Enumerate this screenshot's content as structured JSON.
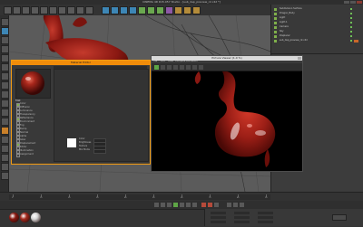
{
  "app": {
    "title": "CINEMA 4D R15.057 Studio - [sub_dep_preview_r2.c4d *]"
  },
  "toolbar": {
    "icons": [
      "undo-icon",
      "redo-icon",
      "select-icon",
      "move-icon",
      "scale-icon",
      "rotate-icon",
      "axis-x-icon",
      "axis-y-icon",
      "axis-z-icon",
      "coord-icon",
      "render-view-icon",
      "render-picture-icon",
      "render-settings-icon",
      "cube-icon",
      "pen-icon",
      "subdivision-icon",
      "array-icon",
      "deformer-icon",
      "scene-icon",
      "camera-icon",
      "light-icon"
    ]
  },
  "object_manager": {
    "rows": [
      {
        "name": "Subdivision Surface"
      },
      {
        "name": "Dragon_Body"
      },
      {
        "name": "Light"
      },
      {
        "name": "Light.1"
      },
      {
        "name": "Camera"
      },
      {
        "name": "Sky"
      },
      {
        "name": "Displacer"
      },
      {
        "name": "sub_dep_preview_r2.c4d"
      }
    ]
  },
  "material_editor": {
    "title": "Material Editor",
    "material_name": "Mat",
    "channels": [
      {
        "label": "Color",
        "on": true
      },
      {
        "label": "Diffusion",
        "on": false
      },
      {
        "label": "Luminance",
        "on": false
      },
      {
        "label": "Transparency",
        "on": false
      },
      {
        "label": "Reflectance",
        "on": true
      },
      {
        "label": "Environment",
        "on": false
      },
      {
        "label": "Fog",
        "on": false
      },
      {
        "label": "Bump",
        "on": false
      },
      {
        "label": "Normal",
        "on": false
      },
      {
        "label": "Alpha",
        "on": false
      },
      {
        "label": "Glow",
        "on": false
      },
      {
        "label": "Displacement",
        "on": true
      },
      {
        "label": "Editor",
        "on": false
      },
      {
        "label": "Illumination",
        "on": false
      },
      {
        "label": "Assignment",
        "on": false
      }
    ],
    "fields": [
      {
        "label": "Color"
      },
      {
        "label": "Brightness"
      },
      {
        "label": "Texture"
      },
      {
        "label": "Mix Mode"
      }
    ],
    "swatch_color": "#ffffff"
  },
  "picture_viewer": {
    "title": "Picture Viewer (1.0 %)",
    "menu": [
      "File",
      "Edit",
      "View",
      "Compare",
      "Animation"
    ]
  },
  "timeline": {
    "ticks": [
      "0",
      "10",
      "20",
      "30",
      "40",
      "50",
      "60",
      "70",
      "80",
      "90"
    ]
  },
  "material_manager": {
    "materials": [
      {
        "color": "#8a1a12"
      },
      {
        "color": "#a32a1e"
      },
      {
        "color": "#d7d7d7"
      }
    ]
  },
  "colors": {
    "accent_orange": "#f08c0a",
    "dragon_red": "#9b1e16",
    "viewport_bg": "#5b5b5b"
  }
}
